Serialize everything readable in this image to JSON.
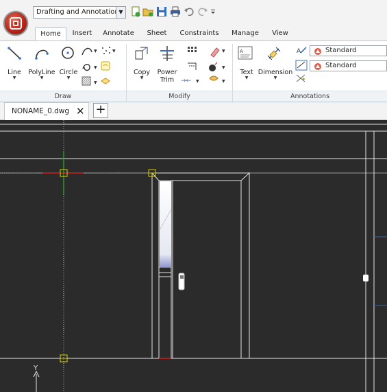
{
  "quick_access": {
    "workspace": "Drafting and Annotation",
    "icons": [
      "new-file-icon",
      "open-file-icon",
      "save-icon",
      "print-icon",
      "undo-icon",
      "redo-icon",
      "customize-icon"
    ]
  },
  "ribbon_tabs": [
    "Home",
    "Insert",
    "Annotate",
    "Sheet",
    "Constraints",
    "Manage",
    "View"
  ],
  "active_tab": "Home",
  "draw_panel": {
    "label": "Draw",
    "line": "Line",
    "polyline": "PolyLine",
    "circle": "Circle"
  },
  "modify_panel": {
    "label": "Modify",
    "copy": "Copy",
    "power": "Power",
    "trim": "Trim"
  },
  "annotations_panel": {
    "label": "Annotations",
    "text": "Text",
    "dimension": "Dimension",
    "text_style": "Standard",
    "dim_style": "Standard"
  },
  "document_tab": {
    "name": "NONAME_0.dwg",
    "close": "✕",
    "new": "+"
  },
  "canvas": {
    "background": "#2b2b2b",
    "ucs_y_label": "Y"
  },
  "colors": {
    "ribbon_bg": "#ffffff",
    "app_button": "#b8261a",
    "drawing_lines": "#e6e6e6",
    "snap_marker": "#d6d600",
    "x_axis": "#d02020",
    "y_axis": "#2a9a2a"
  }
}
